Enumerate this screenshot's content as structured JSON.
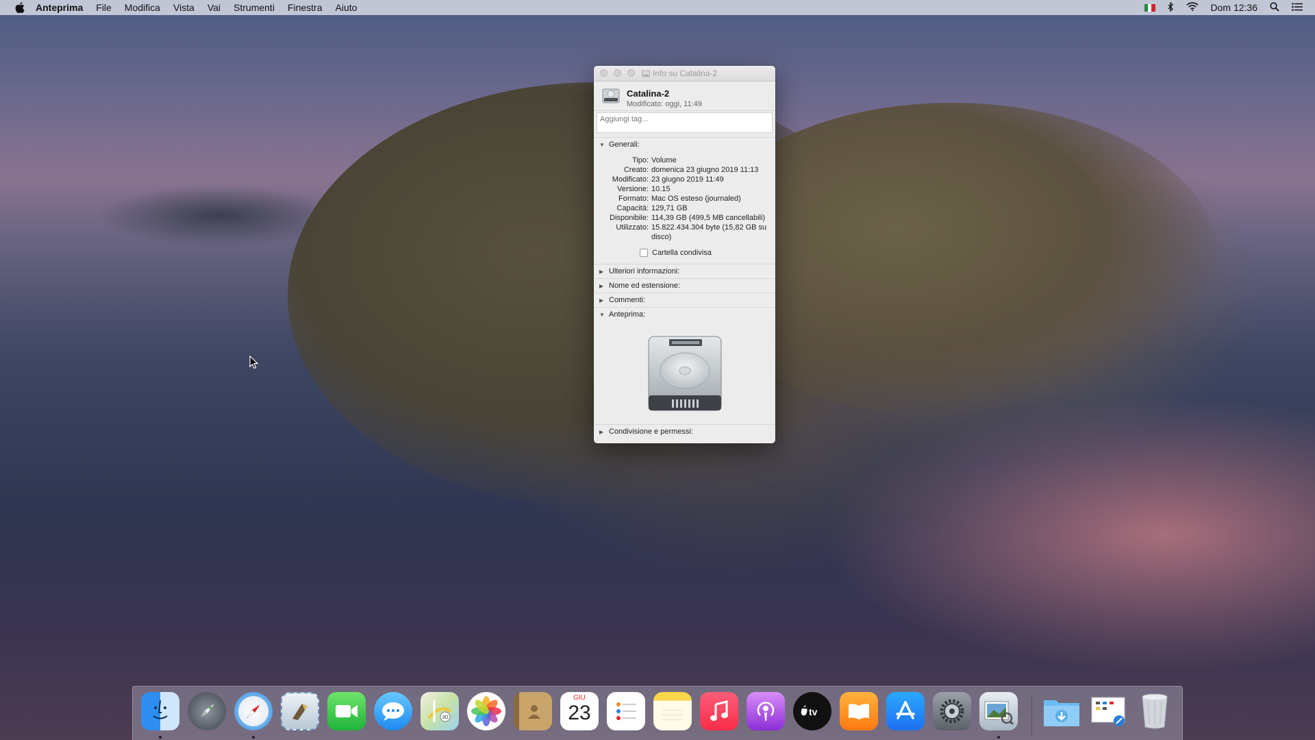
{
  "menubar": {
    "app": "Anteprima",
    "items": [
      "File",
      "Modifica",
      "Vista",
      "Vai",
      "Strumenti",
      "Finestra",
      "Aiuto"
    ],
    "clock": "Dom 12:36"
  },
  "window": {
    "title": "Info su Catalina-2",
    "name": "Catalina-2",
    "modified": "Modificato: oggi, 11:49",
    "tags_placeholder": "Aggiungi tag...",
    "general": {
      "label": "Generali:",
      "rows": [
        {
          "k": "Tipo:",
          "v": "Volume"
        },
        {
          "k": "Creato:",
          "v": "domenica 23 giugno 2019 11:13"
        },
        {
          "k": "Modificato:",
          "v": "23 giugno 2019 11:49"
        },
        {
          "k": "Versione:",
          "v": "10.15"
        },
        {
          "k": "Formato:",
          "v": "Mac OS esteso (journaled)"
        },
        {
          "k": "Capacità:",
          "v": "129,71 GB"
        },
        {
          "k": "Disponibile:",
          "v": "114,39 GB (499,5 MB cancellabili)"
        },
        {
          "k": "Utilizzato:",
          "v": "15.822.434.304 byte (15,82 GB su disco)"
        }
      ],
      "shared_folder": "Cartella condivisa"
    },
    "more_info": "Ulteriori informazioni:",
    "name_ext": "Nome ed estensione:",
    "comments": "Commenti:",
    "preview": "Anteprima:",
    "sharing": "Condivisione e permessi:"
  },
  "dock": {
    "calendar_month": "GIU",
    "calendar_day": "23",
    "apps": [
      "finder-icon",
      "launchpad-icon",
      "safari-icon",
      "mail-icon",
      "facetime-icon",
      "messages-icon",
      "maps-icon",
      "photos-icon",
      "contacts-icon",
      "calendar-icon",
      "reminders-icon",
      "notes-icon",
      "music-icon",
      "podcasts-icon",
      "tv-icon",
      "books-icon",
      "app-store-icon",
      "system-preferences-icon",
      "preview-icon",
      "downloads-folder-icon",
      "screenshot-icon",
      "trash-icon"
    ]
  }
}
